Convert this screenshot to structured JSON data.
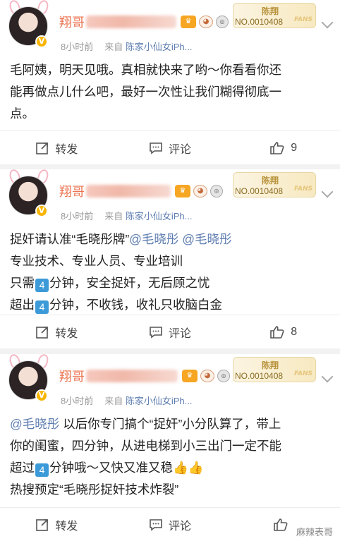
{
  "posts": [
    {
      "author": "翔哥",
      "fan_card": {
        "name": "陈翔",
        "number": "NO.0010408",
        "tag": "FANS"
      },
      "time": "8小时前",
      "source_prefix": "来自",
      "source": "陈家小仙女iPh...",
      "content_lines": [
        "毛阿姨，明天见哦。真相就快来了哟～你看看你还",
        "能再做点儿什么吧，最好一次性让我们糊得彻底一",
        "点。"
      ],
      "actions": {
        "repost": "转发",
        "comment": "评论",
        "likes": "9"
      }
    },
    {
      "author": "翔哥",
      "fan_card": {
        "name": "陈翔",
        "number": "NO.0010408",
        "tag": "FANS"
      },
      "time": "8小时前",
      "source_prefix": "来自",
      "source": "陈家小仙女iPh...",
      "line1_pre": "捉奸请认准“毛晓彤牌”",
      "mention_a": "@毛晓彤",
      "mention_b": "@毛晓彤",
      "line2": "专业技术、专业人员、专业培训",
      "line3_pre": "只需",
      "line3_num": "4",
      "line3_post": "分钟，安全捉奸，无后顾之忧",
      "line4_pre": "超出",
      "line4_num": "4",
      "line4_post": "分钟，不收钱，收礼只收脑白金",
      "actions": {
        "repost": "转发",
        "comment": "评论",
        "likes": "8"
      }
    },
    {
      "author": "翔哥",
      "fan_card": {
        "name": "陈翔",
        "number": "NO.0010408",
        "tag": "FANS"
      },
      "time": "8小时前",
      "source_prefix": "来自",
      "source": "陈家小仙女iPh...",
      "mention": "@毛晓彤",
      "line1_post": " 以后你专门搞个“捉奸”小分队算了，带上",
      "line2": "你的闺蜜，四分钟，从进电梯到小三出门一定不能",
      "line3_pre": "超过",
      "line3_num": "4",
      "line3_post": "分钟哦～又快又准又稳👍👍",
      "line4": "热搜预定“毛晓彤捉奸技术炸裂”",
      "actions": {
        "repost": "转发",
        "comment": "评论"
      }
    }
  ],
  "watermark": "麻辣表哥"
}
